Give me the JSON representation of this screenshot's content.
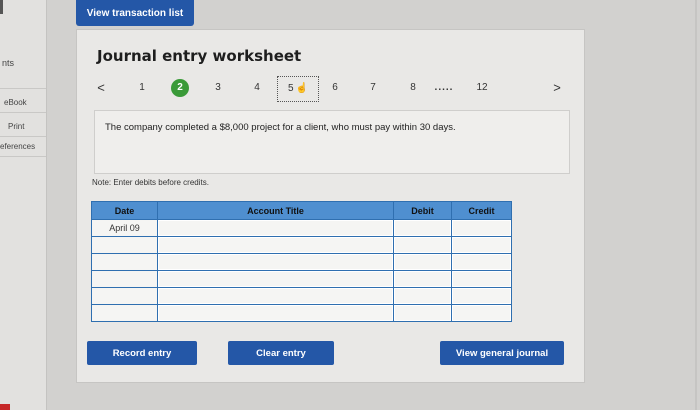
{
  "sidebar": {
    "title_fragment": "nts",
    "items": [
      {
        "label": "eBook"
      },
      {
        "label": "Print"
      },
      {
        "label": "eferences"
      }
    ]
  },
  "header": {
    "view_transaction_label": "View transaction list"
  },
  "worksheet": {
    "title": "Journal entry worksheet",
    "nav": {
      "prev_glyph": "<",
      "next_glyph": ">",
      "pages": [
        "1",
        "2",
        "3",
        "4",
        "5",
        "6",
        "7",
        "8",
        ".....",
        "12"
      ],
      "active_page": "2",
      "hovered_page": "5"
    },
    "problem_text": "The company completed a $8,000 project for a client, who must pay within 30 days.",
    "note": "Note: Enter debits before credits.",
    "table": {
      "headers": [
        "Date",
        "Account Title",
        "Debit",
        "Credit"
      ],
      "rows": [
        [
          "April 09",
          "",
          "",
          ""
        ],
        [
          "",
          "",
          "",
          ""
        ],
        [
          "",
          "",
          "",
          ""
        ],
        [
          "",
          "",
          "",
          ""
        ],
        [
          "",
          "",
          "",
          ""
        ],
        [
          "",
          "",
          "",
          ""
        ]
      ]
    },
    "buttons": {
      "record": "Record entry",
      "clear": "Clear entry",
      "view_journal": "View general journal"
    }
  },
  "colors": {
    "button_blue": "#2457a7",
    "header_blue": "#4f8fd0",
    "active_green": "#3a9a38"
  },
  "icons": {
    "hand_cursor": "hand-pointer-icon"
  }
}
